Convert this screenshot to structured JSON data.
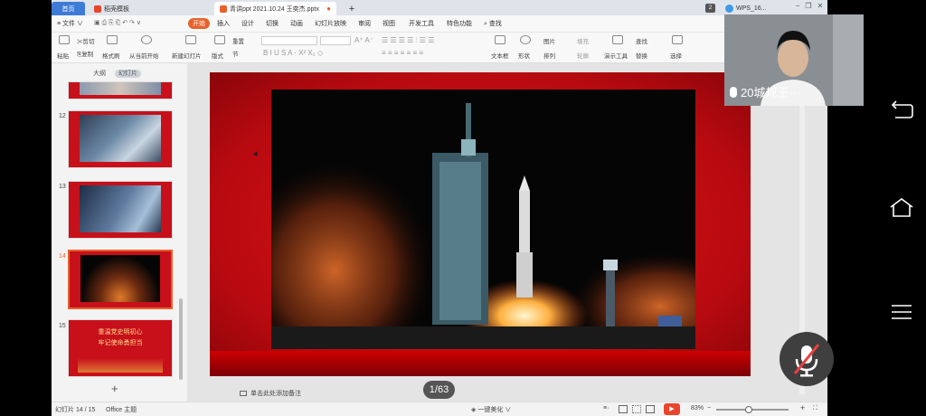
{
  "window": {
    "tabs": [
      {
        "label": "首页",
        "active": true
      },
      {
        "label": "稻壳模板",
        "active": false
      },
      {
        "label": "青讲ppt 2021.10.24 王奕杰.pptx",
        "active": true
      },
      {
        "label": "+"
      }
    ],
    "badge": "2",
    "account": "WPS_16..."
  },
  "menu": {
    "file_label": "≡ 文件 ∨",
    "items": [
      "开始",
      "插入",
      "设计",
      "切换",
      "动画",
      "幻灯片放映",
      "审阅",
      "视图",
      "开发工具",
      "特色功能",
      "查找"
    ]
  },
  "ribbon": {
    "paste": "粘贴",
    "cut": "剪切",
    "copy": "复制",
    "format_painter": "格式刷",
    "from_current": "从当前开始",
    "new_slide": "新建幻灯片",
    "layout": "版式",
    "section": "节",
    "reset": "重置",
    "textbox": "文本框",
    "shape": "形状",
    "arrange": "排列",
    "picture": "图片",
    "fill": "填充",
    "outline": "轮廓",
    "present_tools": "演示工具",
    "find": "查找",
    "replace": "替换",
    "select": "选择"
  },
  "panel": {
    "tab_outline": "大纲",
    "tab_slides": "幻灯片",
    "slides": [
      {
        "number": "12"
      },
      {
        "number": "13"
      },
      {
        "number": "14",
        "active": true
      },
      {
        "number": "15",
        "title_line1": "重温党史明初心",
        "title_line2": "牢记使命勇担当"
      }
    ],
    "add": "+"
  },
  "notes_placeholder": "单击此处添加备注",
  "status": {
    "slide_count": "幻灯片 14 / 15",
    "theme": "Office 主题",
    "beautify": "一键美化 ∨",
    "zoom": "83%",
    "zoom_minus": "−",
    "zoom_plus": "+"
  },
  "page_indicator": "1/63",
  "video_call": {
    "name": "20城规王···"
  },
  "colors": {
    "accent": "#e8612c",
    "slide_red": "#c8101a",
    "tab_blue": "#3e7bd6"
  }
}
